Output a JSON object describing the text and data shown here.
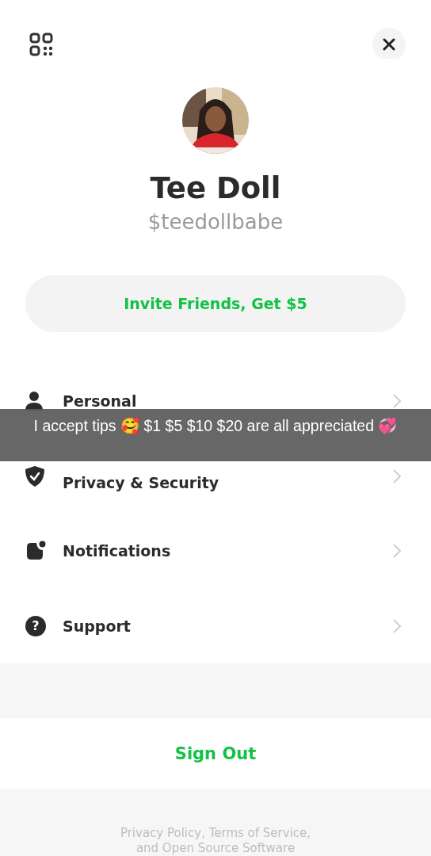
{
  "profile": {
    "name": "Tee Doll",
    "handle": "$teedollbabe"
  },
  "invite_button": {
    "label": "Invite Friends, Get $5"
  },
  "menu": [
    {
      "kind": "person",
      "label": "Personal"
    },
    {
      "kind": "shield",
      "label": "Privacy & Security"
    },
    {
      "kind": "notification",
      "label": "Notifications"
    },
    {
      "kind": "help",
      "label": "Support",
      "icon_text": "?"
    }
  ],
  "sign_out": {
    "label": "Sign Out"
  },
  "footer": [
    "Privacy Policy, Terms of Service,",
    "and Open Source Software"
  ],
  "caption": "I accept tips 🥰 $1 $5 $10 $20 are all appreciated 💞"
}
